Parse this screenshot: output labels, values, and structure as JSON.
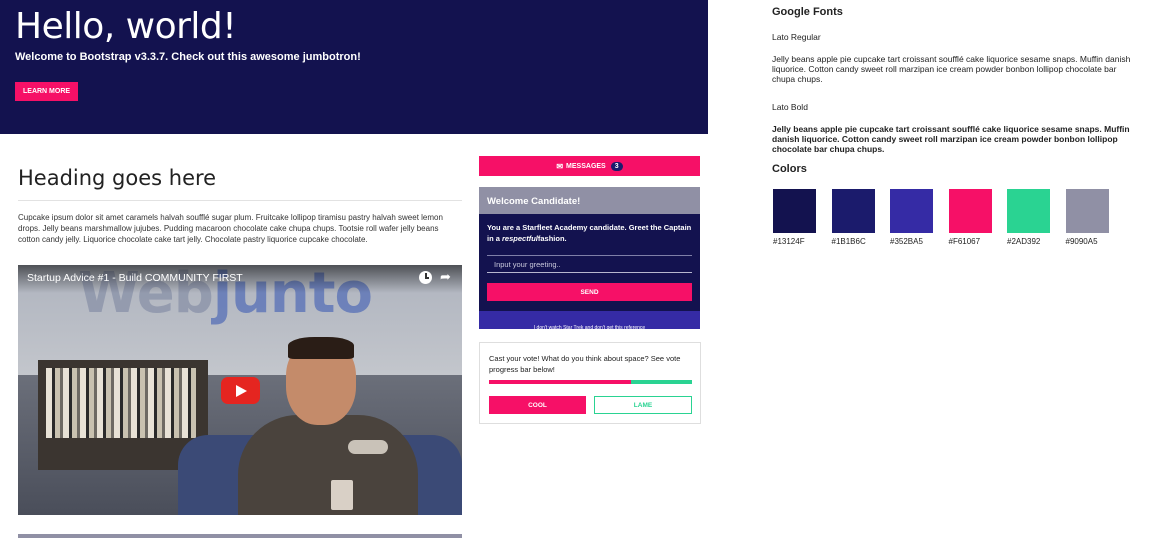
{
  "jumbotron": {
    "title": "Hello, world!",
    "lead": "Welcome to Bootstrap v3.3.7. Check out this awesome jumbotron!",
    "button_label": "LEARN MORE"
  },
  "main": {
    "heading": "Heading goes here",
    "paragraph": "Cupcake ipsum dolor sit amet caramels halvah soufflé sugar plum. Fruitcake lollipop tiramisu pastry halvah sweet lemon drops. Jelly beans marshmallow jujubes. Pudding macaroon chocolate cake chupa chups. Tootsie roll wafer jelly beans cotton candy jelly. Liquorice chocolate cake tart jelly. Chocolate pastry liquorice cupcake chocolate."
  },
  "video": {
    "title": "Startup Advice #1 - Build COMMUNITY FIRST",
    "logo_part1": "Web",
    "logo_part2": "junto",
    "icons": [
      "clock-icon",
      "share-icon",
      "youtube-play-icon"
    ]
  },
  "messages": {
    "icon": "envelope-icon",
    "label": "MESSAGES",
    "count": "3"
  },
  "candidate": {
    "title": "Welcome Candidate!",
    "text_before": "You are a Starfleet Academy candidate. Greet the Captain in a ",
    "text_emphasis": "respectful",
    "text_after": "fashion.",
    "input_placeholder": "Input your greeting..",
    "send_label": "SEND",
    "footer_link": "I don't watch Star Trek and don't get this reference"
  },
  "vote": {
    "question": "Cast your vote! What do you think about space? See vote progress bar below!",
    "progress_fraction": 0.7,
    "cool_label": "COOL",
    "lame_label": "LAME"
  },
  "fonts": {
    "title": "Google Fonts",
    "regular_label": "Lato Regular",
    "regular_sample": "Jelly beans apple pie cupcake tart croissant soufflé cake liquorice sesame snaps. Muffin danish liquorice. Cotton candy sweet roll marzipan ice cream powder bonbon lollipop chocolate bar chupa chups.",
    "bold_label": "Lato Bold",
    "bold_sample": "Jelly beans apple pie cupcake tart croissant soufflé cake liquorice sesame snaps. Muffin danish liquorice. Cotton candy sweet roll marzipan ice cream powder bonbon lollipop chocolate bar chupa chups."
  },
  "colors": {
    "title": "Colors",
    "swatches": [
      {
        "hex": "#13124F"
      },
      {
        "hex": "#1B1B6C"
      },
      {
        "hex": "#352BA5"
      },
      {
        "hex": "#F61067"
      },
      {
        "hex": "#2AD392"
      },
      {
        "hex": "#9090A5"
      }
    ]
  }
}
